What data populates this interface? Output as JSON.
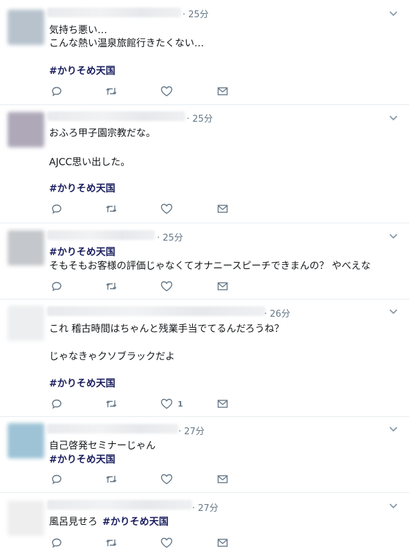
{
  "tweets": [
    {
      "time": "· 25分",
      "lines": [
        "気持ち悪い…",
        "こんな熱い温泉旅館行きたくない…"
      ],
      "hashtag": "#かりそめ天国",
      "like_count": ""
    },
    {
      "time": "· 25分",
      "lines": [
        "おふろ甲子園宗教だな。",
        "AJCC思い出した。"
      ],
      "hashtag": "#かりそめ天国",
      "like_count": ""
    },
    {
      "time": "· 25分",
      "hashtag": "#かりそめ天国",
      "lines": [
        "そもそもお客様の評価じゃなくてオナニースピーチできまんの？ やべえな"
      ],
      "like_count": ""
    },
    {
      "time": "· 26分",
      "lines": [
        "これ 稽古時間はちゃんと残業手当でてるんだろうね？",
        "じゃなきゃクソブラックだよ"
      ],
      "hashtag": "#かりそめ天国",
      "like_count": "1"
    },
    {
      "time": "· 27分",
      "lines": [
        "自己啓発セミナーじゃん"
      ],
      "hashtag": "#かりそめ天国",
      "like_count": ""
    },
    {
      "time": "· 27分",
      "lines": [
        "風呂見せろ"
      ],
      "hashtag": "#かりそめ天国",
      "like_count": ""
    }
  ],
  "icons": {
    "reply": "reply-icon",
    "retweet": "retweet-icon",
    "like": "heart-icon",
    "dm": "envelope-icon",
    "caret": "chevron-down-icon"
  },
  "colors": {
    "hashtag": "#1b1f5e",
    "meta": "#657786",
    "divider": "#e6ecf0"
  }
}
